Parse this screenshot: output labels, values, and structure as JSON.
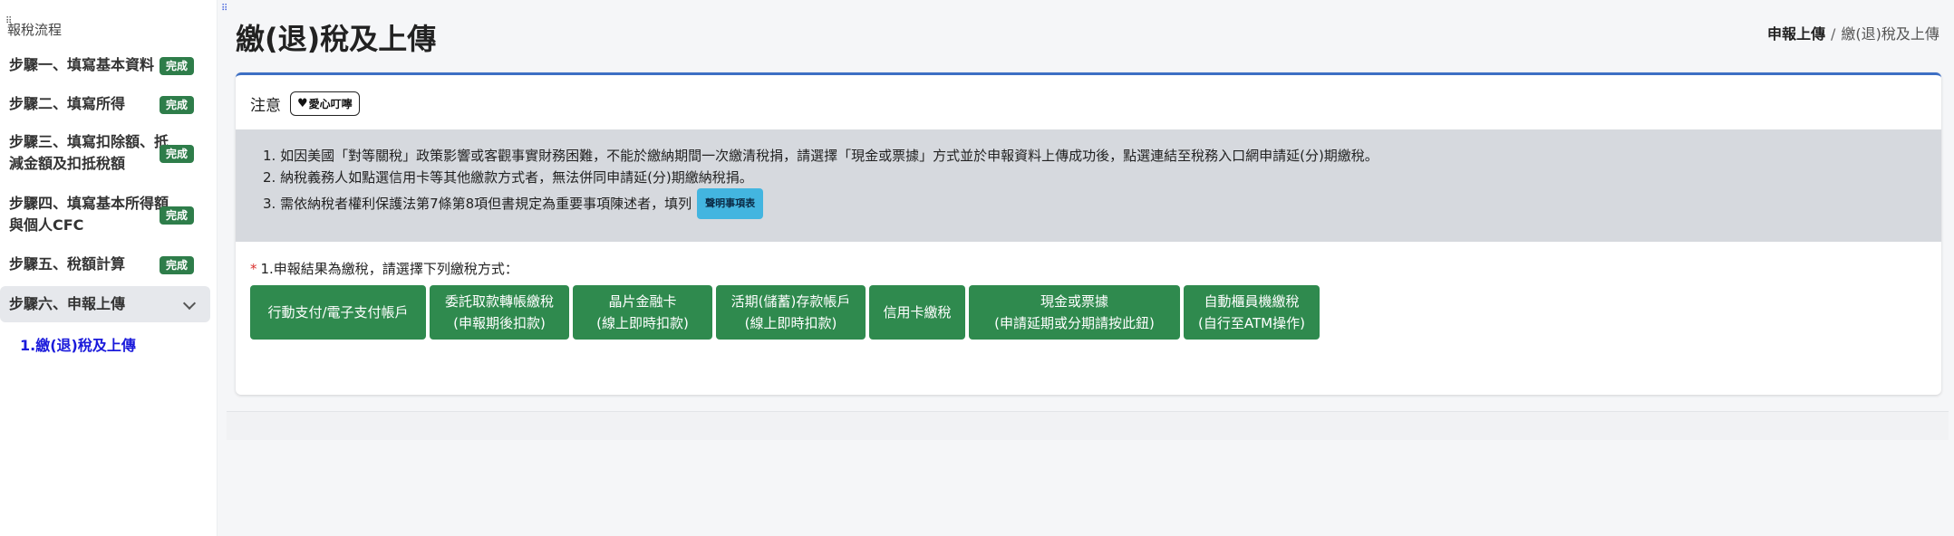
{
  "sidebar": {
    "header": "報稅流程",
    "steps": [
      {
        "label": "步驟一、填寫基本資料",
        "badge": "完成"
      },
      {
        "label": "步驟二、填寫所得",
        "badge": "完成"
      },
      {
        "label_line1": "步驟三、填寫扣除額、抵",
        "label_line2": "減金額及扣抵稅額",
        "badge": "完成"
      },
      {
        "label_line1": "步驟四、填寫基本所得額",
        "label_line2": "與個人CFC",
        "badge": "完成"
      },
      {
        "label": "步驟五、稅額計算",
        "badge": "完成"
      }
    ],
    "active_step": "步驟六、申報上傳",
    "sub_item": "1.繳(退)稅及上傳"
  },
  "header": {
    "title": "繳(退)稅及上傳",
    "breadcrumb": {
      "parent": "申報上傳",
      "separator": "/",
      "current": "繳(退)稅及上傳"
    }
  },
  "notice": {
    "title": "注意",
    "reminder_tag": "愛心叮嚀",
    "lines": [
      "1. 如因美國「對等關稅」政策影響或客觀事實財務困難，不能於繳納期間一次繳清稅捐，請選擇「現金或票據」方式並於申報資料上傳成功後，點選連結至稅務入口網申請延(分)期繳稅。",
      "2. 納稅義務人如點選信用卡等其他繳款方式者，無法併同申請延(分)期繳納稅捐。",
      "3. 需依納稅者權利保護法第7條第8項但書規定為重要事項陳述者，填列"
    ],
    "explain_tag": "聲明事項表"
  },
  "payment": {
    "question_marker": "*",
    "question": "1.申報結果為繳稅，請選擇下列繳稅方式：",
    "buttons": [
      {
        "line1": "行動支付/電子支付帳戶",
        "line2": ""
      },
      {
        "line1": "委託取款轉帳繳稅",
        "line2": "(申報期後扣款)"
      },
      {
        "line1": "晶片金融卡",
        "line2": "(線上即時扣款)"
      },
      {
        "line1": "活期(儲蓄)存款帳戶",
        "line2": "(線上即時扣款)"
      },
      {
        "line1": "信用卡繳稅",
        "line2": ""
      },
      {
        "line1": "現金或票據",
        "line2": "(申請延期或分期請按此鈕)"
      },
      {
        "line1": "自動櫃員機繳稅",
        "line2": "(自行至ATM操作)"
      }
    ]
  },
  "colors": {
    "badge": "#2e7d4a",
    "button": "#2f8a4e",
    "card_top_border": "#3d6fc4",
    "notice_bg": "#d6d9de",
    "explain_tag": "#43b5e0",
    "sub_item": "#1a1adb"
  }
}
